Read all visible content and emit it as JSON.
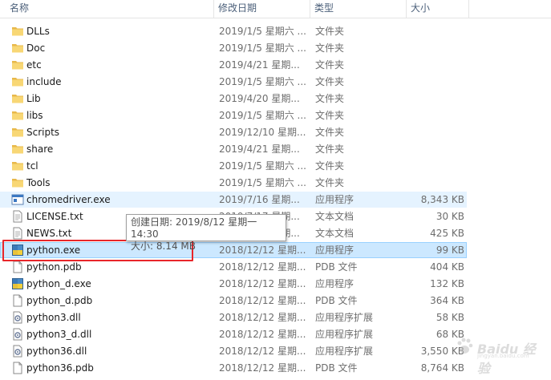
{
  "header": {
    "name": "名称",
    "date": "修改日期",
    "type": "类型",
    "size": "大小"
  },
  "files": [
    {
      "name": "DLLs",
      "date": "2019/1/5 星期六 ...",
      "type": "文件夹",
      "size": "",
      "icon": "folder-icon"
    },
    {
      "name": "Doc",
      "date": "2019/1/5 星期六 ...",
      "type": "文件夹",
      "size": "",
      "icon": "folder-icon"
    },
    {
      "name": "etc",
      "date": "2019/4/21 星期...",
      "type": "文件夹",
      "size": "",
      "icon": "folder-icon"
    },
    {
      "name": "include",
      "date": "2019/1/5 星期六 ...",
      "type": "文件夹",
      "size": "",
      "icon": "folder-icon"
    },
    {
      "name": "Lib",
      "date": "2019/4/20 星期...",
      "type": "文件夹",
      "size": "",
      "icon": "folder-icon"
    },
    {
      "name": "libs",
      "date": "2019/1/5 星期六 ...",
      "type": "文件夹",
      "size": "",
      "icon": "folder-icon"
    },
    {
      "name": "Scripts",
      "date": "2019/12/10 星期...",
      "type": "文件夹",
      "size": "",
      "icon": "folder-icon"
    },
    {
      "name": "share",
      "date": "2019/4/21 星期...",
      "type": "文件夹",
      "size": "",
      "icon": "folder-icon"
    },
    {
      "name": "tcl",
      "date": "2019/1/5 星期六 ...",
      "type": "文件夹",
      "size": "",
      "icon": "folder-icon"
    },
    {
      "name": "Tools",
      "date": "2019/1/5 星期六 ...",
      "type": "文件夹",
      "size": "",
      "icon": "folder-icon"
    },
    {
      "name": "chromedriver.exe",
      "date": "2019/7/16 星期...",
      "type": "应用程序",
      "size": "8,343 KB",
      "icon": "exe-window-icon"
    },
    {
      "name": "LICENSE.txt",
      "date": "2019/7/17 星期...",
      "type": "文本文档",
      "size": "30 KB",
      "icon": "text-file-icon"
    },
    {
      "name": "NEWS.txt",
      "date": "2019/7/17 星期...",
      "type": "文本文档",
      "size": "425 KB",
      "icon": "text-file-icon"
    },
    {
      "name": "python.exe",
      "date": "2018/12/12 星期...",
      "type": "应用程序",
      "size": "99 KB",
      "icon": "python-icon"
    },
    {
      "name": "python.pdb",
      "date": "2018/12/12 星期...",
      "type": "PDB 文件",
      "size": "404 KB",
      "icon": "blank-file-icon"
    },
    {
      "name": "python_d.exe",
      "date": "2018/12/12 星期...",
      "type": "应用程序",
      "size": "132 KB",
      "icon": "python-icon"
    },
    {
      "name": "python_d.pdb",
      "date": "2018/12/12 星期...",
      "type": "PDB 文件",
      "size": "364 KB",
      "icon": "blank-file-icon"
    },
    {
      "name": "python3.dll",
      "date": "2018/12/12 星期...",
      "type": "应用程序扩展",
      "size": "58 KB",
      "icon": "dll-icon"
    },
    {
      "name": "python3_d.dll",
      "date": "2018/12/12 星期...",
      "type": "应用程序扩展",
      "size": "68 KB",
      "icon": "dll-icon"
    },
    {
      "name": "python36.dll",
      "date": "2018/12/12 星期...",
      "type": "应用程序扩展",
      "size": "3,550 KB",
      "icon": "dll-icon"
    },
    {
      "name": "python36.pdb",
      "date": "2018/12/12 星期...",
      "type": "PDB 文件",
      "size": "8,764 KB",
      "icon": "blank-file-icon"
    }
  ],
  "tooltip": {
    "created": "创建日期: 2019/8/12 星期一 14:30",
    "size": "大小: 8.14 MB"
  },
  "watermark": {
    "text": "Baidu 经验",
    "sub": "jingyan.baidu.com"
  },
  "colors": {
    "selected_bg": "#cce8ff",
    "hover_bg": "#e5f3ff",
    "highlight_border": "#e8262a",
    "folder": "#f8d775"
  }
}
